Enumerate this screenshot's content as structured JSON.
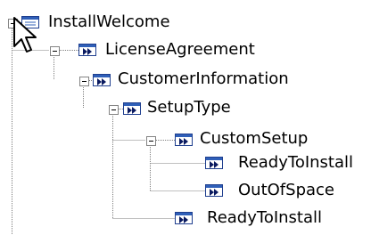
{
  "tree": {
    "nodes": [
      {
        "id": "install-welcome",
        "label": "InstallWelcome",
        "icon": "dialog-icon",
        "expanded": true
      },
      {
        "id": "license-agreement",
        "label": "LicenseAgreement",
        "icon": "next-icon",
        "expanded": true
      },
      {
        "id": "customer-information",
        "label": "CustomerInformation",
        "icon": "next-icon",
        "expanded": true
      },
      {
        "id": "setup-type",
        "label": "SetupType",
        "icon": "next-icon",
        "expanded": true
      },
      {
        "id": "custom-setup",
        "label": "CustomSetup",
        "icon": "next-icon",
        "expanded": true
      },
      {
        "id": "ready-to-install-1",
        "label": "ReadyToInstall",
        "icon": "next-icon"
      },
      {
        "id": "out-of-space",
        "label": "OutOfSpace",
        "icon": "next-icon"
      },
      {
        "id": "ready-to-install-2",
        "label": "ReadyToInstall",
        "icon": "next-icon"
      }
    ]
  },
  "colors": {
    "tree_line": "#808080",
    "icon_border": "#1f3f8f",
    "icon_fill": "#2f5fb8",
    "background": "#ffffff"
  }
}
